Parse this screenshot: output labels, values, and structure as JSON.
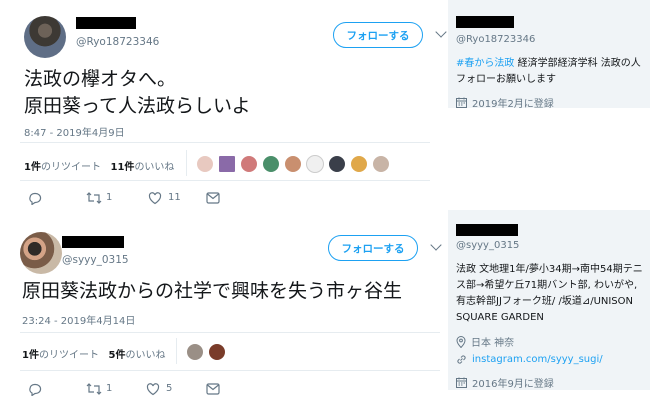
{
  "tweet1": {
    "handle": "@Ryo18723346",
    "follow_label": "フォローする",
    "text_line1": "法政の欅オタへ。",
    "text_line2": "原田葵って人法政らしいよ",
    "timestamp": "8:47 - 2019年4月9日",
    "retweets_count": "1件",
    "retweets_label": "のリツイート",
    "likes_count": "11件",
    "likes_label": "のいいね",
    "reply_count": "",
    "retweet_action_count": "1",
    "like_action_count": "11"
  },
  "profile1": {
    "handle": "@Ryo18723346",
    "bio_hashtag": "#春から法政",
    "bio_rest1": " 経済学部経済学科 法政の人",
    "bio_line2": "フォローお願いします",
    "joined": "2019年2月に登録"
  },
  "tweet2": {
    "handle": "@syyy_0315",
    "follow_label": "フォローする",
    "text": "原田葵法政からの社学で興味を失う市ヶ谷生",
    "timestamp": "23:24 - 2019年4月14日",
    "retweets_count": "1件",
    "retweets_label": "のリツイート",
    "likes_count": "5件",
    "likes_label": "のいいね",
    "retweet_action_count": "1",
    "like_action_count": "5"
  },
  "profile2": {
    "handle": "@syyy_0315",
    "bio_line1": "法政 文地理1年/夢小34期→南中54期テニ",
    "bio_line2": "ス部→希望ケ丘71期バント部, わいがや,",
    "bio_line3": "有志幹部JJフォーク班/ /坂道⊿/UNISON",
    "bio_line4": "SQUARE GARDEN",
    "location": "日本 神奈",
    "link": "instagram.com/syyy_sugi/",
    "joined": "2016年9月に登録"
  },
  "colors": {
    "accent": "#1da1f2",
    "muted": "#657786",
    "text": "#14171a",
    "panel": "#f0f4f7"
  }
}
